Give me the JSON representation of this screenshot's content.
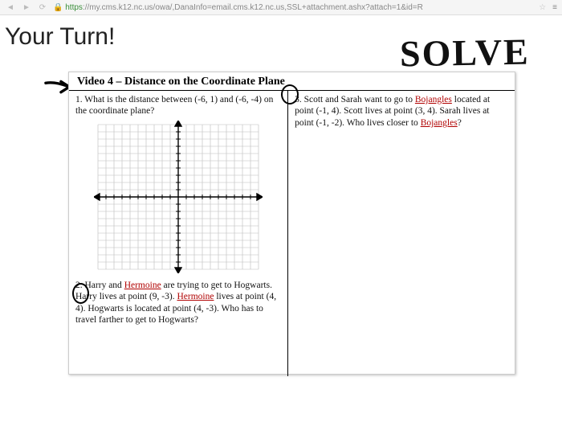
{
  "browser": {
    "url_prefix": "https",
    "url_host": "://my.cms.k12.nc.us",
    "url_rest": "/owa/,DanaInfo=email.cms.k12.nc.us,SSL+attachment.ashx?attach=1&id=R"
  },
  "page": {
    "title": "Your Turn!",
    "annotation": "SOLVE"
  },
  "worksheet": {
    "heading": "Video 4 – Distance on the Coordinate Plane",
    "q1": {
      "num": "1.",
      "text_a": "What is the distance between (-6, 1) and (-6, -4) on the coordinate plane?"
    },
    "q2": {
      "num": "2.",
      "text_a": "Harry and ",
      "u1": "Hermoine",
      "text_b": " are trying to get to Hogwarts.  Harry lives at point (9, -3).  ",
      "u2": "Hermoine",
      "text_c": " lives at point (4, 4).  Hogwarts is located at point (4, -3).  Who has to travel farther to get to Hogwarts?"
    },
    "q3": {
      "num": "3.",
      "text_a": "Scott and Sarah want to go to ",
      "u1": "Bojangles",
      "text_b": " located at point (-1, 4).  Scott lives at point (3, 4).  Sarah lives at point (-1, -2).  Who lives closer to ",
      "u2": "Bojangles",
      "text_c": "?"
    }
  },
  "chart_data": {
    "type": "scatter",
    "title": "",
    "xlabel": "",
    "ylabel": "",
    "xlim": [
      -10,
      10
    ],
    "ylim": [
      -10,
      10
    ],
    "grid": true,
    "series": []
  }
}
